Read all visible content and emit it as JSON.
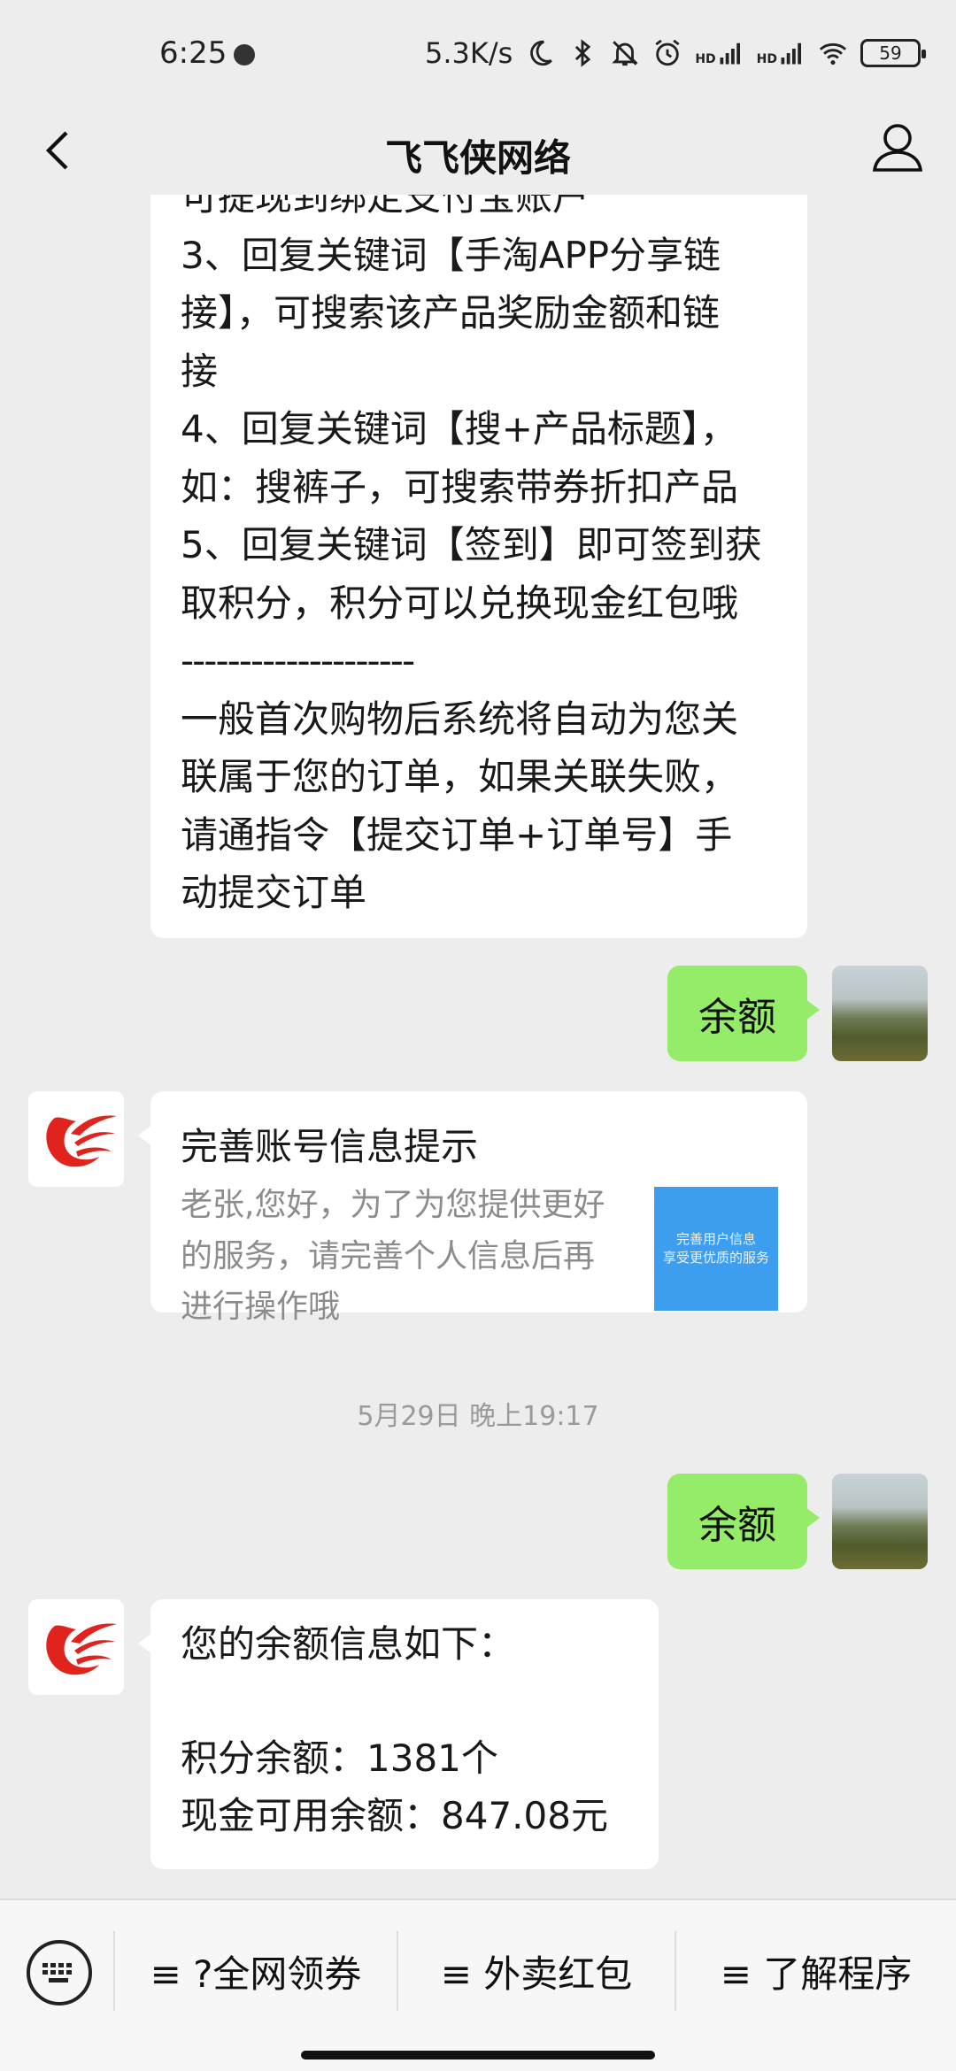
{
  "status_bar": {
    "time": "6:25",
    "network_speed": "5.3K/s",
    "battery": "59",
    "signal_label_1": "HD",
    "signal_label_2": "HD"
  },
  "nav": {
    "title": "飞飞侠网络"
  },
  "messages": {
    "bot_long": {
      "lines": [
        "可提现到绑定支付宝账户",
        "3、回复关键词【手淘APP分享链",
        "接】，可搜索该产品奖励金额和链",
        "接",
        "4、回复关键词【搜+产品标题】，",
        "如：搜裤子，可搜索带券折扣产品",
        "5、回复关键词【签到】即可签到获",
        "取积分，积分可以兑换现金红包哦",
        "--------------------",
        "一般首次购物后系统将自动为您关",
        "联属于您的订单，如果关联失败，",
        "请通指令【提交订单+订单号】手",
        "动提交订单"
      ]
    },
    "user_1": "余额",
    "card": {
      "title": "完善账号信息提示",
      "desc_lines": [
        "老张,您好，为了为您提供更好",
        "的服务，请完善个人信息后再",
        "进行操作哦"
      ],
      "thumb_line_1": "完善用户信息",
      "thumb_line_2": "享受更优质的服务"
    },
    "timestamp": "5月29日 晚上19:17",
    "user_2": "余额",
    "bot_balance": {
      "lines": [
        "您的余额信息如下：",
        "",
        "积分余额：1381个",
        "现金可用余额：847.08元"
      ]
    }
  },
  "bottom_menu": {
    "items": [
      {
        "label": "≡ ?全网领券"
      },
      {
        "label": "≡ 外卖红包"
      },
      {
        "label": "≡ 了解程序"
      }
    ]
  },
  "colors": {
    "background": "#ededed",
    "user_bubble": "#95ec69",
    "bot_bubble": "#ffffff",
    "thumb": "#3d9ef0",
    "logo_red": "#e0231c"
  }
}
